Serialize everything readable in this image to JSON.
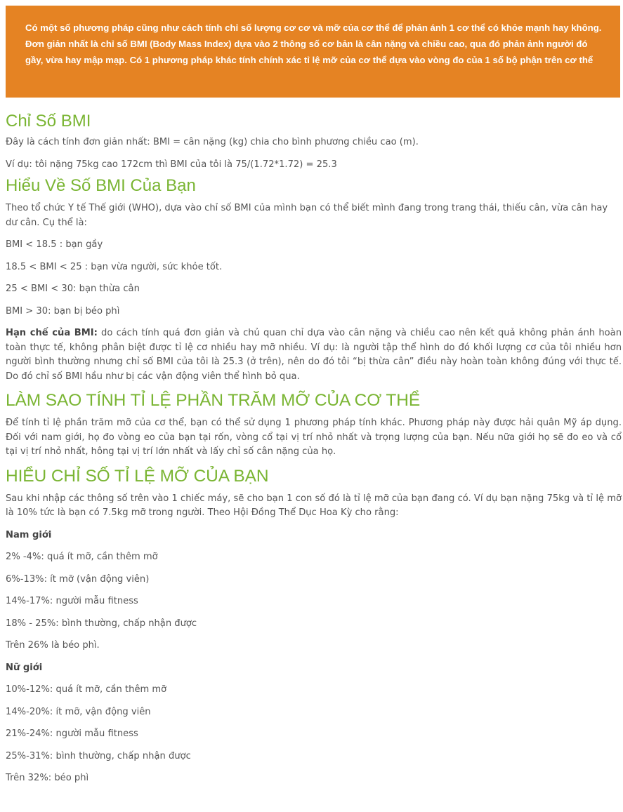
{
  "intro": "Có một số phương pháp cũng như cách tính chỉ số lượng cơ cơ và mỡ của cơ thể để phản ánh 1 cơ thể có khỏe mạnh hay không. Đơn giản nhất là chỉ số BMI (Body Mass Index) dựa vào 2 thông số cơ bản là cân nặng và chiều cao, qua đó phản ảnh người đó gầy, vừa hay mập mạp. Có 1 phương pháp khác tính chính xác tỉ lệ mỡ của cơ thể dựa vào vòng đo của 1 số bộ phận trên cơ thể",
  "bmi": {
    "title": "Chỉ Số BMI",
    "p1": "Đây là cách tính đơn giản nhất: BMI = cân nặng (kg) chia cho bình phương chiều cao (m).",
    "p2": "Ví dụ: tôi nặng 75kg cao 172cm thì BMI của tôi là 75/(1.72*1.72) = 25.3"
  },
  "understand_bmi": {
    "title": "Hiểu Về Số BMI Của Bạn",
    "intro": "Theo tổ chức Y tế Thế giới (WHO), dựa vào chỉ số BMI của mình bạn có thể biết mình đang trong trang thái, thiếu cân, vừa cân hay dư cân. Cụ thể là:",
    "items": [
      "BMI < 18.5 : bạn gầy",
      "18.5 < BMI < 25 : bạn vừa người, sức khỏe tốt.",
      "25 < BMI < 30: bạn thừa cân",
      "BMI > 30: bạn bị béo phì"
    ],
    "limit_label": "Hạn chế của BMI:",
    "limit_text": " do cách tính quá đơn giản và chủ quan chỉ dựa vào cân nặng và chiều cao nên kết quả không phản ánh hoàn toàn thực tế, không phân biệt được tỉ lệ cơ nhiều hay mỡ nhiều. Ví dụ: là người tập thể hình do đó khối lượng cơ của tôi nhiều hơn người bình thường nhưng chỉ số BMI của tôi là 25.3 (ở trên), nên do đó tôi “bị thừa cân” điều này hoàn toàn không đúng với thực tế. Do đó chỉ số BMI hầu như bị các vận động viên thể hình bỏ qua."
  },
  "calc_fat": {
    "title": "LÀM SAO TÍNH TỈ LỆ PHẦN TRĂM MỠ CỦA CƠ THỂ",
    "text": "Để tính tỉ lệ phần trăm mỡ của cơ thể, bạn có thể sử dụng 1 phương pháp tính khác. Phương pháp này được hải quân Mỹ áp dụng. Đối với nam giới, họ đo vòng eo của bạn tại rốn, vòng cổ tại vị trí nhỏ nhất và trọng lượng của bạn. Nếu nữa giới họ sẽ đo eo và cổ tại vị trí nhỏ nhất, hông tại vị trí lớn nhất và lấy chỉ số cân nặng của họ."
  },
  "understand_fat": {
    "title": "HIỂU CHỈ SỐ TỈ LỆ MỠ CỦA BẠN",
    "text": "Sau khi nhập các thông số trên vào 1 chiếc máy, sẽ cho bạn 1 con số đó là tỉ lệ mỡ của bạn đang có. Ví dụ bạn nặng 75kg và tỉ lệ mỡ là 10% tức là bạn có 7.5kg mỡ trong người. Theo Hội Đồng Thể Dục Hoa Kỳ cho rằng:",
    "men_label": "Nam giới",
    "men": [
      "2% -4%: quá ít mỡ, cần thêm mỡ",
      "6%-13%: ít mỡ (vận động viên)",
      "14%-17%: người mẫu fitness",
      "18% - 25%: bình thường, chấp nhận được",
      "Trên 26% là béo phì."
    ],
    "women_label": "Nữ giới",
    "women": [
      "10%-12%: quá ít mỡ, cần thêm mỡ",
      "14%-20%: ít mỡ, vận động viên",
      "21%-24%: người mẫu fitness",
      "25%-31%: bình thường, chấp nhận được",
      "Trên 32%: béo phì"
    ]
  }
}
